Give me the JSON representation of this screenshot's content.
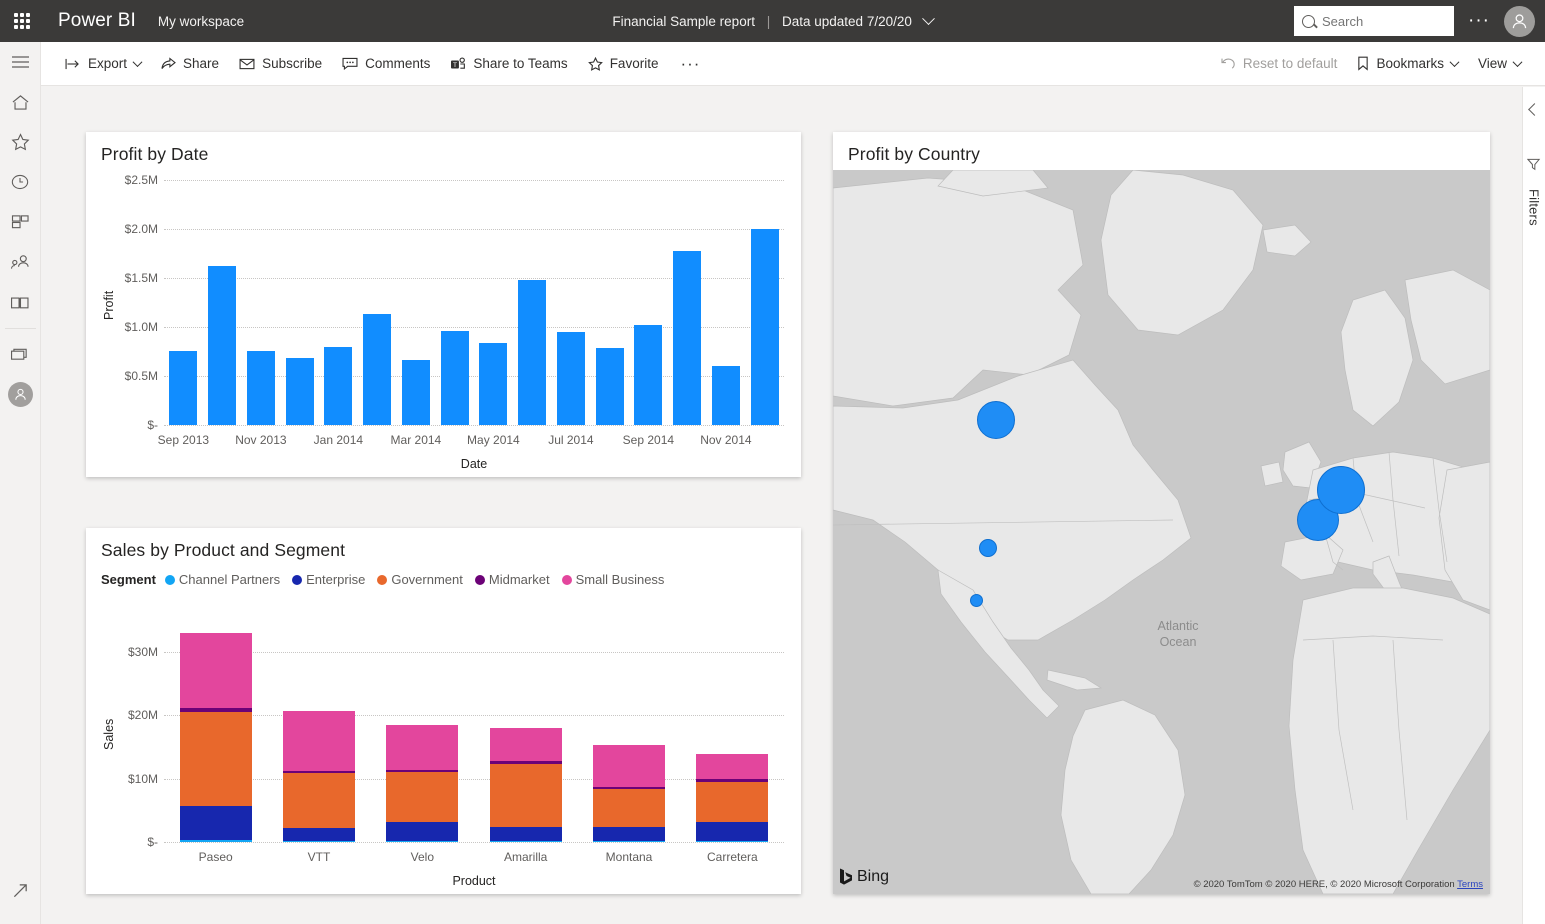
{
  "topbar": {
    "waffle_icon": "app-launcher-icon",
    "brand": "Power BI",
    "workspace": "My workspace",
    "report_title": "Financial Sample report",
    "separator": "|",
    "data_updated": "Data updated 7/20/20",
    "search_placeholder": "Search",
    "search_value": "",
    "more_label": "···",
    "avatar_icon": "user-avatar-icon",
    "bg_color": "#3b3a39"
  },
  "rail": {
    "items": [
      {
        "name": "navigation-menu",
        "icon": "hamburger-icon",
        "label": "Navigation"
      },
      {
        "name": "home",
        "icon": "home-icon",
        "label": "Home"
      },
      {
        "name": "favorites",
        "icon": "star-icon",
        "label": "Favorites"
      },
      {
        "name": "recent",
        "icon": "clock-icon",
        "label": "Recent"
      },
      {
        "name": "apps",
        "icon": "apps-icon",
        "label": "Apps"
      },
      {
        "name": "shared-with-me",
        "icon": "people-icon",
        "label": "Shared with me"
      },
      {
        "name": "learn",
        "icon": "book-icon",
        "label": "Learn"
      },
      {
        "name": "workspaces",
        "icon": "workspaces-icon",
        "label": "Workspaces"
      },
      {
        "name": "my-workspace",
        "icon": "workspace-avatar-icon",
        "label": "My workspace"
      }
    ],
    "bottom": {
      "name": "expand-arrow",
      "icon": "arrow-up-right-icon",
      "label": "Open in new"
    }
  },
  "commandbar": {
    "left": [
      {
        "name": "export-button",
        "icon": "export-icon",
        "label": "Export",
        "caret": true,
        "disabled": false
      },
      {
        "name": "share-button",
        "icon": "share-icon",
        "label": "Share",
        "caret": false,
        "disabled": false
      },
      {
        "name": "subscribe-button",
        "icon": "mail-icon",
        "label": "Subscribe",
        "caret": false,
        "disabled": false
      },
      {
        "name": "comments-button",
        "icon": "comment-icon",
        "label": "Comments",
        "caret": false,
        "disabled": false
      },
      {
        "name": "share-to-teams-button",
        "icon": "teams-icon",
        "label": "Share to Teams",
        "caret": false,
        "disabled": false
      },
      {
        "name": "favorite-button",
        "icon": "star-outline-icon",
        "label": "Favorite",
        "caret": false,
        "disabled": false
      }
    ],
    "left_more": "···",
    "right": [
      {
        "name": "reset-to-default-button",
        "icon": "undo-icon",
        "label": "Reset to default",
        "caret": false,
        "disabled": true
      },
      {
        "name": "bookmarks-button",
        "icon": "bookmark-icon",
        "label": "Bookmarks",
        "caret": true,
        "disabled": false
      },
      {
        "name": "view-button",
        "icon": "",
        "label": "View",
        "caret": true,
        "disabled": false
      }
    ]
  },
  "filter_pane": {
    "collapse_icon": "chevron-left-icon",
    "filter_icon": "filter-icon",
    "label": "Filters"
  },
  "visuals": {
    "profit_by_date_title": "Profit by Date",
    "sales_by_product_title": "Sales by Product and Segment",
    "profit_by_country_title": "Profit by Country"
  },
  "map": {
    "ocean_label": "Atlantic\nOcean",
    "ocean_label_line1": "Atlantic",
    "ocean_label_line2": "Ocean",
    "provider_logo": "Bing",
    "attribution": "© 2020 TomTom © 2020 HERE, © 2020 Microsoft Corporation",
    "terms_link": "Terms",
    "bubble_color": "#1f8df5",
    "bubbles": [
      {
        "country": "Canada",
        "x": 163,
        "y": 250,
        "r": 19
      },
      {
        "country": "United States",
        "x": 155,
        "y": 378,
        "r": 9
      },
      {
        "country": "Mexico",
        "x": 143,
        "y": 430,
        "r": 6.5
      },
      {
        "country": "France",
        "x": 485,
        "y": 350,
        "r": 21
      },
      {
        "country": "Germany",
        "x": 508,
        "y": 320,
        "r": 24
      }
    ]
  },
  "chart_data": [
    {
      "id": "profit-by-date",
      "type": "bar",
      "title": "Profit by Date",
      "xlabel": "Date",
      "ylabel": "Profit",
      "ylim": [
        0,
        2500000
      ],
      "ytick_labels": [
        "$-",
        "$0.5M",
        "$1.0M",
        "$1.5M",
        "$2.0M",
        "$2.5M"
      ],
      "ytick_values": [
        0,
        500000,
        1000000,
        1500000,
        2000000,
        2500000
      ],
      "grid": true,
      "bar_color": "#118DFF",
      "categories": [
        "Sep 2013",
        "Oct 2013",
        "Nov 2013",
        "Dec 2013",
        "Jan 2014",
        "Feb 2014",
        "Mar 2014",
        "Apr 2014",
        "May 2014",
        "Jun 2014",
        "Jul 2014",
        "Aug 2014",
        "Sep 2014",
        "Oct 2014",
        "Nov 2014",
        "Dec 2014"
      ],
      "xtick_labels": [
        "Sep 2013",
        "",
        "Nov 2013",
        "",
        "Jan 2014",
        "",
        "Mar 2014",
        "",
        "May 2014",
        "",
        "Jul 2014",
        "",
        "Sep 2014",
        "",
        "Nov 2014",
        ""
      ],
      "values": [
        760000,
        1620000,
        760000,
        680000,
        800000,
        1130000,
        660000,
        960000,
        840000,
        1480000,
        950000,
        790000,
        1020000,
        1780000,
        600000,
        2000000
      ]
    },
    {
      "id": "sales-by-product-and-segment",
      "type": "bar",
      "stacked": true,
      "title": "Sales by Product and Segment",
      "xlabel": "Product",
      "ylabel": "Sales",
      "legend_title": "Segment",
      "legend_position": "top",
      "ylim": [
        0,
        35000000
      ],
      "ytick_labels": [
        "$-",
        "$10M",
        "$20M",
        "$30M"
      ],
      "ytick_values": [
        0,
        10000000,
        20000000,
        30000000
      ],
      "grid": true,
      "categories": [
        "Paseo",
        "VTT",
        "Velo",
        "Amarilla",
        "Montana",
        "Carretera"
      ],
      "series": [
        {
          "name": "Channel Partners",
          "color": "#12A5F4",
          "values": [
            300000,
            200000,
            220000,
            200000,
            180000,
            200000
          ]
        },
        {
          "name": "Enterprise",
          "color": "#1727AE",
          "values": [
            5300000,
            2000000,
            2900000,
            2200000,
            2200000,
            2900000
          ]
        },
        {
          "name": "Government",
          "color": "#E8682C",
          "values": [
            14900000,
            8700000,
            7900000,
            9900000,
            6000000,
            6400000
          ]
        },
        {
          "name": "Midmarket",
          "color": "#6C0277",
          "values": [
            700000,
            300000,
            300000,
            400000,
            300000,
            400000
          ]
        },
        {
          "name": "Small Business",
          "color": "#E3469D",
          "values": [
            11800000,
            9500000,
            7200000,
            5200000,
            6600000,
            3900000
          ]
        }
      ]
    }
  ]
}
